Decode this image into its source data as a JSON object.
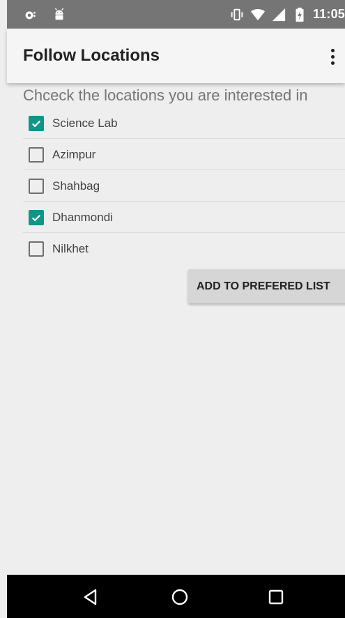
{
  "status_bar": {
    "left_icons": [
      "notification-icon",
      "android-icon"
    ],
    "right_icons": [
      "vibrate-icon",
      "wifi-icon",
      "signal-icon",
      "battery-icon"
    ],
    "time": "11:05"
  },
  "app_bar": {
    "title": "Follow Locations",
    "overflow_icon": "more-vert-icon"
  },
  "instruction": "Chceck the locations you are interested in",
  "locations": [
    {
      "label": "Science Lab",
      "checked": true
    },
    {
      "label": "Azimpur",
      "checked": false
    },
    {
      "label": "Shahbag",
      "checked": false
    },
    {
      "label": "Dhanmondi",
      "checked": true
    },
    {
      "label": "Nilkhet",
      "checked": false
    }
  ],
  "add_button_label": "ADD TO PREFERED LIST",
  "nav_bar": {
    "buttons": [
      "back-icon",
      "home-icon",
      "recents-icon"
    ]
  },
  "colors": {
    "accent": "#109688",
    "status_bar": "#757575",
    "app_bar": "#f5f5f5",
    "background": "#eeeeee",
    "nav_bar": "#000000"
  }
}
